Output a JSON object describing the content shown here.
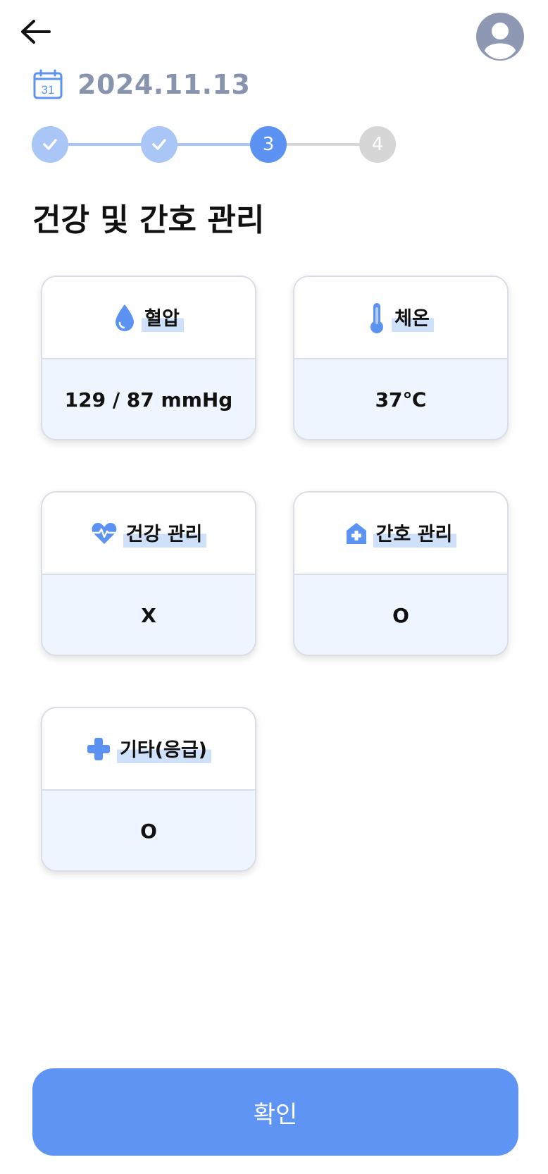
{
  "header": {
    "back_icon": "arrow-left-icon",
    "profile_icon": "user-avatar-icon"
  },
  "date": {
    "icon": "calendar-icon",
    "calendar_day": "31",
    "value": "2024.11.13"
  },
  "stepper": {
    "steps": [
      {
        "label": "",
        "state": "done"
      },
      {
        "label": "",
        "state": "done"
      },
      {
        "label": "3",
        "state": "active"
      },
      {
        "label": "4",
        "state": "todo"
      }
    ],
    "current_step": 3,
    "total_steps": 4
  },
  "section": {
    "title": "건강 및 간호 관리"
  },
  "cards": [
    {
      "label": "혈압",
      "icon": "water-drop-icon",
      "value": "129 / 87 mmHg"
    },
    {
      "label": "체온",
      "icon": "thermometer-icon",
      "value": "37℃"
    },
    {
      "label": "건강 관리",
      "icon": "heartbeat-icon",
      "value": "X"
    },
    {
      "label": "간호 관리",
      "icon": "clinic-house-icon",
      "value": "O"
    },
    {
      "label": "기타(응급)",
      "icon": "medical-cross-icon",
      "value": "O"
    }
  ],
  "footer": {
    "confirm_label": "확인"
  },
  "colors": {
    "primary": "#5e95f5",
    "step_done": "#a9c6f7",
    "step_todo": "#d6d6d6",
    "date_text": "#8893ad",
    "card_value_bg": "#eff5fe",
    "label_highlight": "#cfe0fb"
  }
}
